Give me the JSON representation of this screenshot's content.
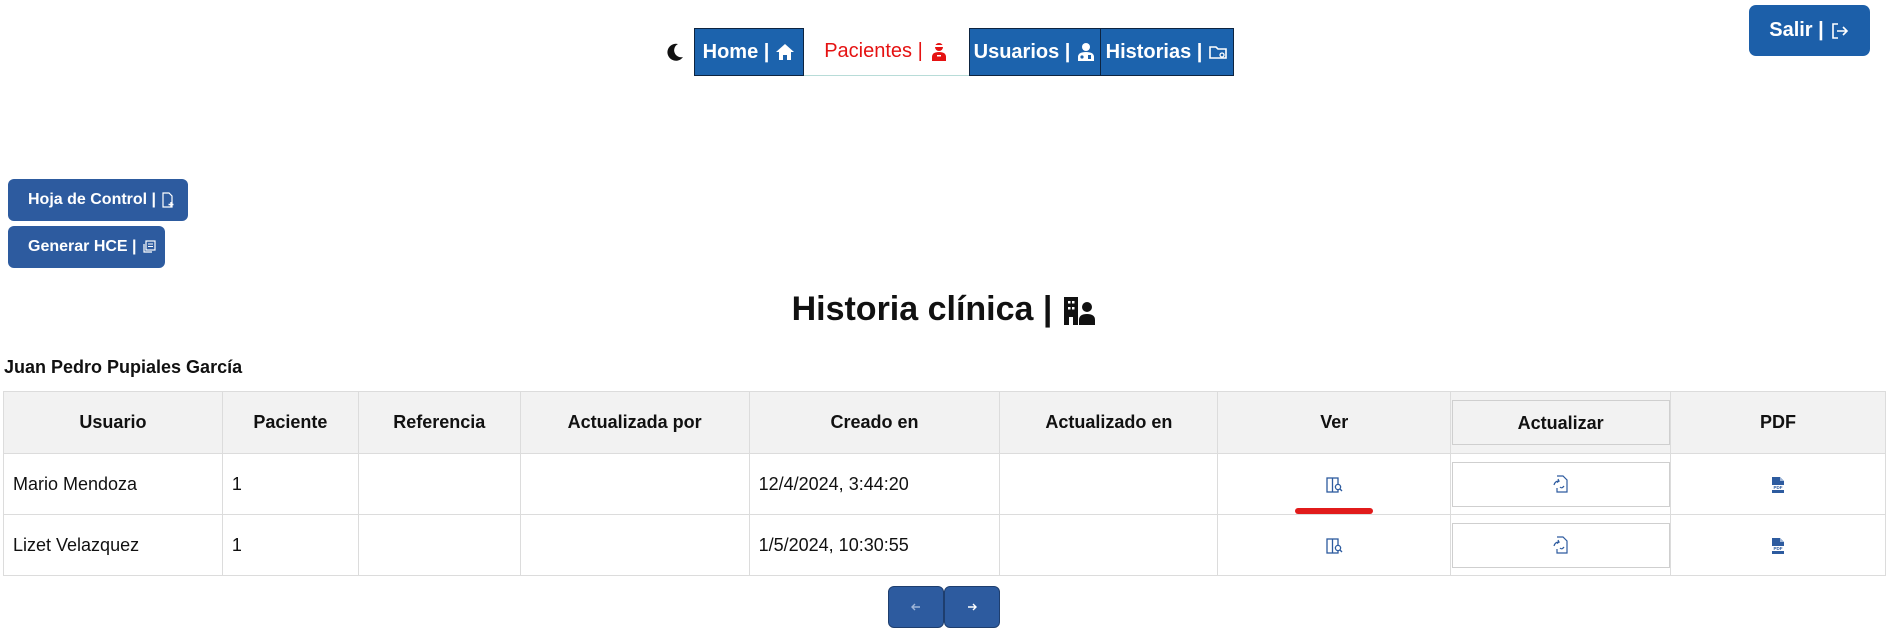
{
  "nav": {
    "home_label": "Home |",
    "pacientes_label": "Pacientes |",
    "usuarios_label": "Usuarios |",
    "historias_label": "Historias |"
  },
  "salir_label": "Salir |",
  "actions": {
    "hoja_label": "Hoja de Control |",
    "hce_label": "Generar HCE |"
  },
  "page_title": "Historia clínica |",
  "patient_name": "Juan Pedro Pupiales García",
  "table": {
    "headers": [
      "Usuario",
      "Paciente",
      "Referencia",
      "Actualizada por",
      "Creado en",
      "Actualizado en",
      "Ver",
      "Actualizar",
      "PDF"
    ],
    "rows": [
      {
        "usuario": "Mario Mendoza",
        "paciente": "1",
        "referencia": "",
        "actualizada_por": "",
        "creado_en": "12/4/2024, 3:44:20",
        "actualizado_en": ""
      },
      {
        "usuario": "Lizet Velazquez",
        "paciente": "1",
        "referencia": "",
        "actualizada_por": "",
        "creado_en": "1/5/2024, 10:30:55",
        "actualizado_en": ""
      }
    ]
  },
  "colors": {
    "nav_blue": "#1c63ad",
    "active_red": "#e51212",
    "button_blue": "#2d5b9f",
    "highlight_red": "#e11b1b"
  },
  "icons": {
    "theme": "moon-icon",
    "home": "house-icon",
    "pacientes": "patient-icon",
    "usuarios": "doctor-icon",
    "historias": "folder-icon",
    "salir": "logout-icon",
    "hoja": "file-plus-icon",
    "hce": "copy-icon",
    "title": "hospital-user-icon",
    "ver": "view-record-icon",
    "actualizar": "refresh-document-icon",
    "pdf": "pdf-icon",
    "prev": "arrow-left-icon",
    "next": "arrow-right-icon"
  }
}
